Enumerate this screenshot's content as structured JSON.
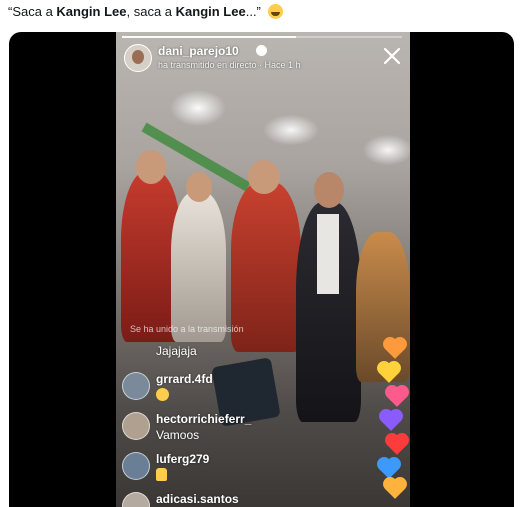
{
  "tweet": {
    "text_part1": "“Saca a ",
    "name1": "Kangin Lee",
    "text_part2": ", saca a ",
    "name2": "Kangin Lee",
    "text_part3": "...” ",
    "emoji": "laughing-tears-emoji"
  },
  "story": {
    "username": "dani_parejo10",
    "subline": "ha transmitido en directo · Hace 1 h",
    "progress": 0.62,
    "verified_icon": "verified-badge-icon",
    "close_icon": "close-icon",
    "comment_hint": "Se ha unido a la transmisión",
    "comments": [
      {
        "name": "",
        "text": "Jajajaja",
        "emoji": ""
      },
      {
        "name": "grrard.4fd",
        "text": "",
        "emoji": "grinning-face-emoji"
      },
      {
        "name": "hectorrichieferr_",
        "text": "Vamoos",
        "emoji": ""
      },
      {
        "name": "luferg279",
        "text": "",
        "emoji": "thumbs-up-emoji"
      },
      {
        "name": "adicasi.santos",
        "text": "",
        "emoji": ""
      }
    ],
    "heart_colors": [
      "#ff9a3c",
      "#ffd23c",
      "#ff5a8c",
      "#8a5cff",
      "#ff3b3b",
      "#3c9aff",
      "#ffb23c"
    ]
  }
}
